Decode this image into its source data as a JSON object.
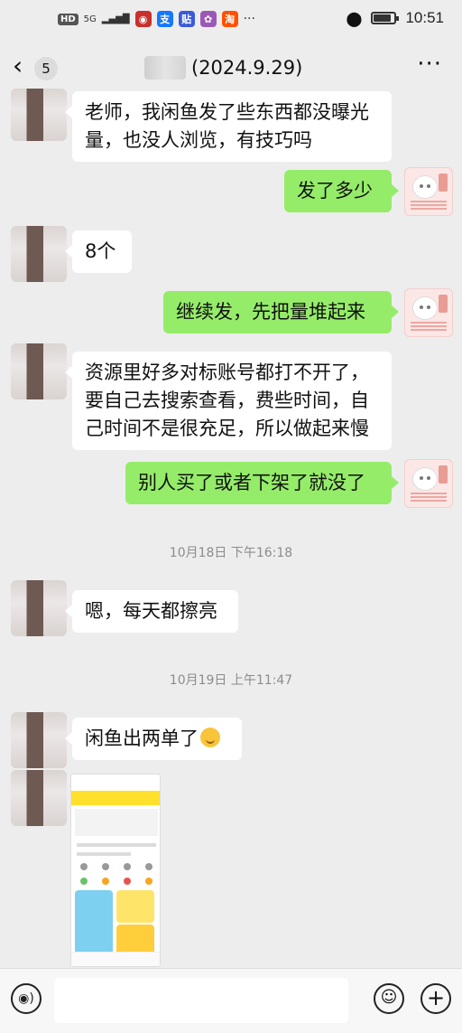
{
  "status_bar": {
    "network": "HD",
    "signal": "5G",
    "apps": [
      {
        "icon": "red-circle-app-icon",
        "glyph": "◉",
        "color": "#c9302c"
      },
      {
        "icon": "alipay-icon",
        "glyph": "支",
        "color": "#1677ff"
      },
      {
        "icon": "tieba-icon",
        "glyph": "贴",
        "color": "#3b5bdb"
      },
      {
        "icon": "colorful-app-icon",
        "glyph": "✿",
        "color": "#9b59b6"
      },
      {
        "icon": "taobao-icon",
        "glyph": "淘",
        "color": "#ff5000"
      }
    ],
    "overflow": "···",
    "time": "10:51"
  },
  "nav": {
    "unread_count": "5",
    "title": "(2024.9.29)"
  },
  "messages": [
    {
      "side": "in",
      "text_lines": [
        "老师，我闲鱼发了些东西都没曝光",
        "量，也没人浏览，有技巧吗"
      ]
    },
    {
      "side": "out",
      "text": "发了多少"
    },
    {
      "side": "in",
      "text": "8个"
    },
    {
      "side": "out",
      "text": "继续发，先把量堆起来"
    },
    {
      "side": "in",
      "text_lines": [
        "资源里好多对标账号都打不开了，",
        "要自己去搜索查看，费些时间，自",
        "己时间不是很充足，所以做起来慢"
      ]
    },
    {
      "side": "out",
      "text": "别人买了或者下架了就没了"
    },
    {
      "type": "timestamp",
      "text": "10月18日 下午16:18"
    },
    {
      "side": "in",
      "text": "嗯，每天都擦亮"
    },
    {
      "type": "timestamp",
      "text": "10月19日 上午11:47"
    },
    {
      "side": "in",
      "text": "闲鱼出两单了"
    },
    {
      "side": "in",
      "type": "image",
      "description_icon": "xianyu-screenshot-image"
    }
  ],
  "thumbnail": {
    "accent": "#ffe02b"
  },
  "colors": {
    "background": "#ededed",
    "outgoing_bubble": "#95ec69",
    "incoming_bubble": "#ffffff",
    "timestamp": "#8c8c8c"
  }
}
